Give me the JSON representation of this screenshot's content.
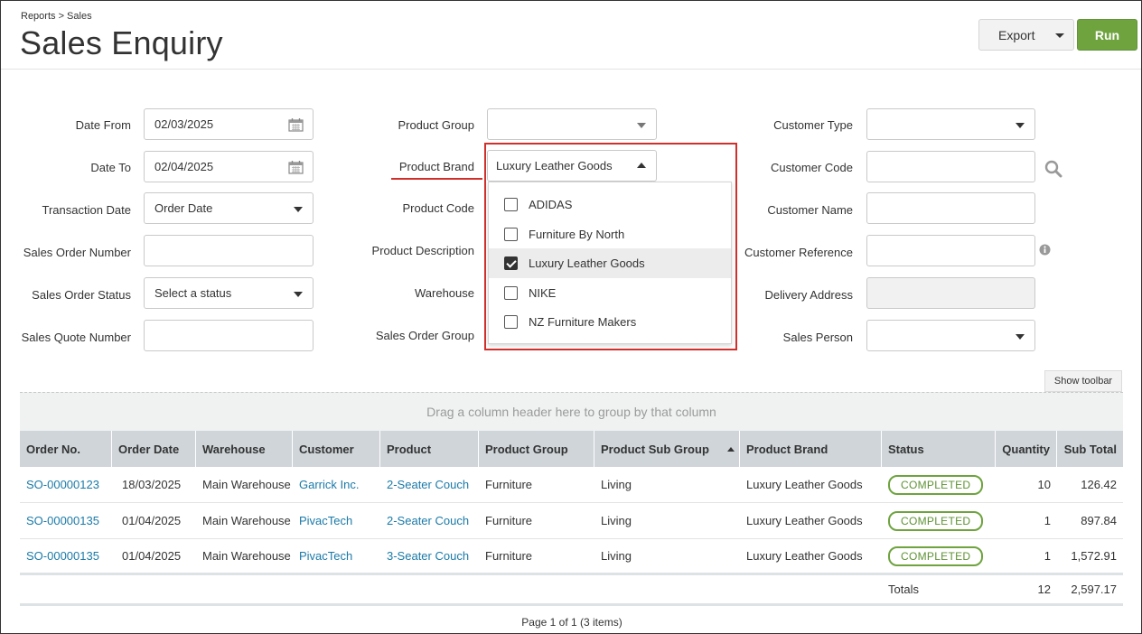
{
  "header": {
    "breadcrumb": "Reports > Sales",
    "title": "Sales Enquiry",
    "export_label": "Export",
    "run_label": "Run"
  },
  "filters": {
    "col1": [
      {
        "label": "Date From",
        "value": "02/03/2025",
        "kind": "date"
      },
      {
        "label": "Date To",
        "value": "02/04/2025",
        "kind": "date"
      },
      {
        "label": "Transaction Date",
        "value": "Order Date",
        "kind": "select"
      },
      {
        "label": "Sales Order Number",
        "value": "",
        "kind": "text"
      },
      {
        "label": "Sales Order Status",
        "value": "Select a status",
        "kind": "select"
      },
      {
        "label": "Sales Quote Number",
        "value": "",
        "kind": "text"
      }
    ],
    "col2": [
      {
        "label": "Product Group",
        "value": "",
        "kind": "select"
      },
      {
        "label": "Product Brand",
        "value": "Luxury Leather Goods",
        "kind": "select-open"
      },
      {
        "label": "Product Code",
        "value": "",
        "kind": "text"
      },
      {
        "label": "Product Description",
        "value": "",
        "kind": "text"
      },
      {
        "label": "Warehouse",
        "value": "",
        "kind": "select"
      },
      {
        "label": "Sales Order Group",
        "value": "",
        "kind": "select"
      }
    ],
    "col3": [
      {
        "label": "Customer Type",
        "value": "",
        "kind": "select"
      },
      {
        "label": "Customer Code",
        "value": "",
        "kind": "text-search"
      },
      {
        "label": "Customer Name",
        "value": "",
        "kind": "text"
      },
      {
        "label": "Customer Reference",
        "value": "",
        "kind": "text-info"
      },
      {
        "label": "Delivery Address",
        "value": "",
        "kind": "disabled"
      },
      {
        "label": "Sales Person",
        "value": "",
        "kind": "select"
      }
    ],
    "brand_options": [
      {
        "label": "ADIDAS",
        "checked": false
      },
      {
        "label": "Furniture By North",
        "checked": false
      },
      {
        "label": "Luxury Leather Goods",
        "checked": true
      },
      {
        "label": "NIKE",
        "checked": false
      },
      {
        "label": "NZ Furniture Makers",
        "checked": false
      }
    ]
  },
  "grid": {
    "show_toolbar_label": "Show toolbar",
    "group_hint": "Drag a column header here to group by that column",
    "columns": [
      "Order No.",
      "Order Date",
      "Warehouse",
      "Customer",
      "Product",
      "Product Group",
      "Product Sub Group",
      "Product Brand",
      "Status",
      "Quantity",
      "Sub Total"
    ],
    "rows": [
      [
        "SO-00000123",
        "18/03/2025",
        "Main Warehouse",
        "Garrick Inc.",
        "2-Seater Couch",
        "Furniture",
        "Living",
        "Luxury Leather Goods",
        "COMPLETED",
        "10",
        "126.42"
      ],
      [
        "SO-00000135",
        "01/04/2025",
        "Main Warehouse",
        "PivacTech",
        "2-Seater Couch",
        "Furniture",
        "Living",
        "Luxury Leather Goods",
        "COMPLETED",
        "1",
        "897.84"
      ],
      [
        "SO-00000135",
        "01/04/2025",
        "Main Warehouse",
        "PivacTech",
        "3-Seater Couch",
        "Furniture",
        "Living",
        "Luxury Leather Goods",
        "COMPLETED",
        "1",
        "1,572.91"
      ]
    ],
    "totals": {
      "label": "Totals",
      "quantity": "12",
      "sub_total": "2,597.17"
    },
    "pager": "Page 1 of 1 (3 items)"
  },
  "colors": {
    "run_button": "#6ea33e",
    "link": "#1a7aa8",
    "status_completed": "#6ea33e",
    "highlight": "#d0302c"
  }
}
